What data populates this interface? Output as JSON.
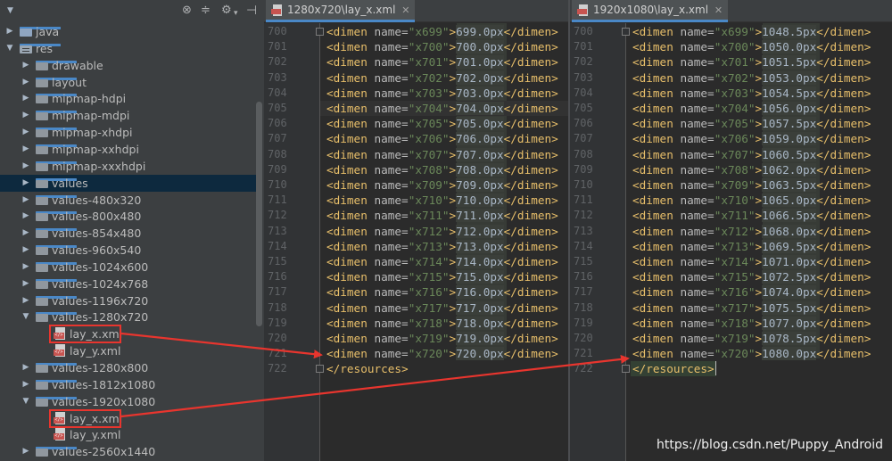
{
  "tree": {
    "items": [
      {
        "label": "java",
        "type": "plain",
        "arrow": "collapsed",
        "indent": 0
      },
      {
        "label": "res",
        "type": "res",
        "arrow": "expanded",
        "indent": 0
      },
      {
        "label": "drawable",
        "type": "folder",
        "arrow": "collapsed",
        "indent": 1
      },
      {
        "label": "layout",
        "type": "folder",
        "arrow": "collapsed",
        "indent": 1
      },
      {
        "label": "mipmap-hdpi",
        "type": "folder",
        "arrow": "collapsed",
        "indent": 1
      },
      {
        "label": "mipmap-mdpi",
        "type": "folder",
        "arrow": "collapsed",
        "indent": 1
      },
      {
        "label": "mipmap-xhdpi",
        "type": "folder",
        "arrow": "collapsed",
        "indent": 1
      },
      {
        "label": "mipmap-xxhdpi",
        "type": "folder",
        "arrow": "collapsed",
        "indent": 1
      },
      {
        "label": "mipmap-xxxhdpi",
        "type": "folder",
        "arrow": "collapsed",
        "indent": 1
      },
      {
        "label": "values",
        "type": "folder",
        "arrow": "collapsed",
        "indent": 1,
        "selected": true
      },
      {
        "label": "values-480x320",
        "type": "folder",
        "arrow": "collapsed",
        "indent": 1
      },
      {
        "label": "values-800x480",
        "type": "folder",
        "arrow": "collapsed",
        "indent": 1
      },
      {
        "label": "values-854x480",
        "type": "folder",
        "arrow": "collapsed",
        "indent": 1
      },
      {
        "label": "values-960x540",
        "type": "folder",
        "arrow": "collapsed",
        "indent": 1
      },
      {
        "label": "values-1024x600",
        "type": "folder",
        "arrow": "collapsed",
        "indent": 1
      },
      {
        "label": "values-1024x768",
        "type": "folder",
        "arrow": "collapsed",
        "indent": 1
      },
      {
        "label": "values-1196x720",
        "type": "folder",
        "arrow": "collapsed",
        "indent": 1
      },
      {
        "label": "values-1280x720",
        "type": "folder",
        "arrow": "expanded",
        "indent": 1
      },
      {
        "label": "lay_x.xml",
        "type": "xml",
        "indent": 2,
        "boxed": true
      },
      {
        "label": "lay_y.xml",
        "type": "xml",
        "indent": 2
      },
      {
        "label": "values-1280x800",
        "type": "folder",
        "arrow": "collapsed",
        "indent": 1
      },
      {
        "label": "values-1812x1080",
        "type": "folder",
        "arrow": "collapsed",
        "indent": 1
      },
      {
        "label": "values-1920x1080",
        "type": "folder",
        "arrow": "expanded",
        "indent": 1
      },
      {
        "label": "lay_x.xml",
        "type": "xml",
        "indent": 2,
        "boxed": true
      },
      {
        "label": "lay_y.xml",
        "type": "xml",
        "indent": 2
      },
      {
        "label": "values-2560x1440",
        "type": "folder",
        "arrow": "collapsed",
        "indent": 1
      }
    ]
  },
  "editor_left": {
    "tab_label": "1280x720\\lay_x.xml",
    "line_numbers": [
      "700",
      "701",
      "702",
      "703",
      "704",
      "705",
      "706",
      "707",
      "708",
      "709",
      "710",
      "711",
      "712",
      "713",
      "714",
      "715",
      "716",
      "717",
      "718",
      "719",
      "720",
      "721",
      "722"
    ],
    "names": [
      "x699",
      "x700",
      "x701",
      "x702",
      "x703",
      "x704",
      "x705",
      "x706",
      "x707",
      "x708",
      "x709",
      "x710",
      "x711",
      "x712",
      "x713",
      "x714",
      "x715",
      "x716",
      "x717",
      "x718",
      "x719",
      "x720"
    ],
    "values": [
      "699.0px",
      "700.0px",
      "701.0px",
      "702.0px",
      "703.0px",
      "704.0px",
      "705.0px",
      "706.0px",
      "707.0px",
      "708.0px",
      "709.0px",
      "710.0px",
      "711.0px",
      "712.0px",
      "713.0px",
      "714.0px",
      "715.0px",
      "716.0px",
      "717.0px",
      "718.0px",
      "719.0px",
      "720.0px"
    ],
    "closing": "</resources>"
  },
  "editor_right": {
    "tab_label": "1920x1080\\lay_x.xml",
    "line_numbers": [
      "700",
      "701",
      "702",
      "703",
      "704",
      "705",
      "706",
      "707",
      "708",
      "709",
      "710",
      "711",
      "712",
      "713",
      "714",
      "715",
      "716",
      "717",
      "718",
      "719",
      "720",
      "721",
      "722"
    ],
    "names": [
      "x699",
      "x700",
      "x701",
      "x702",
      "x703",
      "x704",
      "x705",
      "x706",
      "x707",
      "x708",
      "x709",
      "x710",
      "x711",
      "x712",
      "x713",
      "x714",
      "x715",
      "x716",
      "x717",
      "x718",
      "x719",
      "x720"
    ],
    "values": [
      "1048.5px",
      "1050.0px",
      "1051.5px",
      "1053.0px",
      "1054.5px",
      "1056.0px",
      "1057.5px",
      "1059.0px",
      "1060.5px",
      "1062.0px",
      "1063.5px",
      "1065.0px",
      "1066.5px",
      "1068.0px",
      "1069.5px",
      "1071.0px",
      "1072.5px",
      "1074.0px",
      "1075.5px",
      "1077.0px",
      "1078.5px",
      "1080.0px"
    ],
    "closing": "</resources>"
  },
  "code_parts": {
    "open_tag": "<dimen ",
    "attr_name": "name=",
    "close_tag": "</dimen>"
  },
  "watermark": "https://blog.csdn.net/Puppy_Android",
  "colors": {
    "annotation_red": "#e8352e",
    "selection": "#0d293e",
    "tag": "#e8bf6a",
    "string": "#6a8759"
  }
}
